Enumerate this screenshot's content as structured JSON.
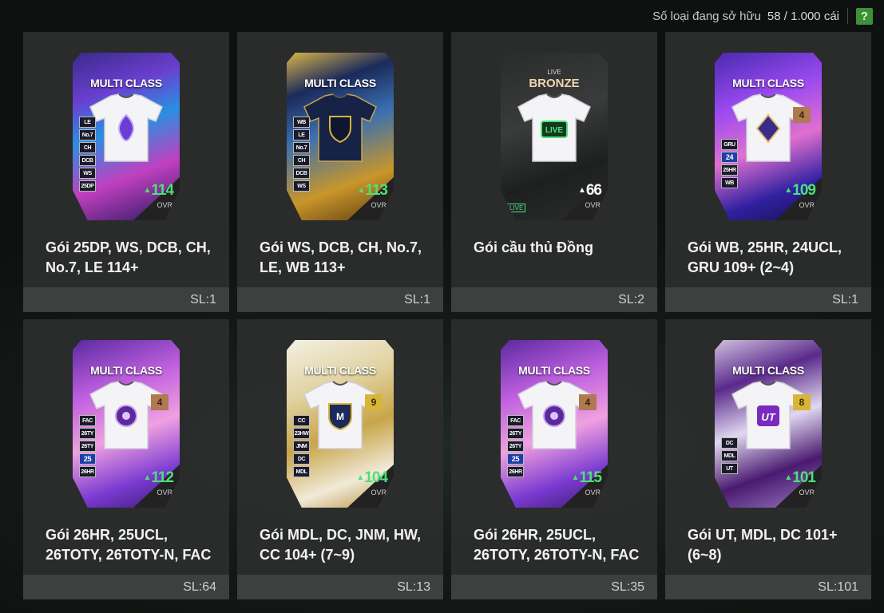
{
  "header": {
    "owned_label": "Số loại đang sở hữu",
    "owned_count": "58 / 1.000 cái",
    "help_label": "?"
  },
  "colors": {
    "ovr_green": "#4ee07a",
    "help_green": "#3e8f3a",
    "tile_bg": "#2c2e2e"
  },
  "packs": [
    {
      "title": "Gói 25DP, WS, DCB, CH, No.7, LE 114+",
      "qty": "SL:1",
      "card": {
        "class_label": "MULTI CLASS",
        "ovr": "114",
        "ovr_label": "OVR",
        "badges": [
          "LE",
          "No.7",
          "CH",
          "DCB",
          "WS",
          "25DP"
        ],
        "level": "",
        "theme": "purple-storm",
        "icon": "flame-crest-icon"
      }
    },
    {
      "title": "Gói WS, DCB, CH, No.7, LE, WB 113+",
      "qty": "SL:1",
      "card": {
        "class_label": "MULTI CLASS",
        "ovr": "113",
        "ovr_label": "OVR",
        "badges": [
          "WB",
          "LE",
          "No.7",
          "CH",
          "DCB",
          "WS"
        ],
        "level": "",
        "theme": "gold-navy",
        "icon": "shield-crest-icon"
      }
    },
    {
      "title": "Gói cầu thủ Đồng",
      "qty": "SL:2",
      "card": {
        "class_label": "BRONZE",
        "top_label": "LIVE",
        "ovr": "66",
        "ovr_label": "OVR",
        "badges": [],
        "level": "",
        "theme": "bronze-live",
        "icon": "live-icon",
        "live_tag": "LIVE",
        "shirt_text": "LIVE"
      }
    },
    {
      "title": "Gói WB, 25HR, 24UCL, GRU 109+ (2~4)",
      "qty": "SL:1",
      "card": {
        "class_label": "MULTI CLASS",
        "ovr": "109",
        "ovr_label": "OVR",
        "badges": [
          "GRU",
          "24",
          "25HR",
          "WB"
        ],
        "level": "4",
        "theme": "violet-prism",
        "icon": "diamond-crest-icon"
      }
    },
    {
      "title": "Gói 26HR, 25UCL, 26TOTY, 26TOTY-N, FAC",
      "qty": "SL:64",
      "card": {
        "class_label": "MULTI CLASS",
        "ovr": "112",
        "ovr_label": "OVR",
        "badges": [
          "FAC",
          "26TY",
          "26TY",
          "25",
          "26HR"
        ],
        "level": "4",
        "theme": "violet-pink",
        "icon": "ball-crest-icon"
      }
    },
    {
      "title": "Gói MDL, DC, JNM, HW, CC 104+ (7~9)",
      "qty": "SL:13",
      "card": {
        "class_label": "MULTI CLASS",
        "ovr": "104",
        "ovr_label": "OVR",
        "badges": [
          "CC",
          "23HW",
          "JNM",
          "DC",
          "MDL"
        ],
        "level": "9",
        "theme": "white-gold",
        "icon": "m-crest-icon"
      }
    },
    {
      "title": "Gói 26HR, 25UCL, 26TOTY, 26TOTY-N, FAC",
      "qty": "SL:35",
      "card": {
        "class_label": "MULTI CLASS",
        "ovr": "115",
        "ovr_label": "OVR",
        "badges": [
          "FAC",
          "26TY",
          "26TY",
          "25",
          "26HR"
        ],
        "level": "4",
        "theme": "violet-pink",
        "icon": "ball-crest-icon"
      }
    },
    {
      "title": "Gói UT, MDL, DC 101+ (6~8)",
      "qty": "SL:101",
      "card": {
        "class_label": "MULTI CLASS",
        "ovr": "101",
        "ovr_label": "OVR",
        "badges": [
          "DC",
          "MDL",
          "UT"
        ],
        "level": "8",
        "theme": "purple-shard",
        "icon": "ut-crest-icon"
      }
    }
  ]
}
